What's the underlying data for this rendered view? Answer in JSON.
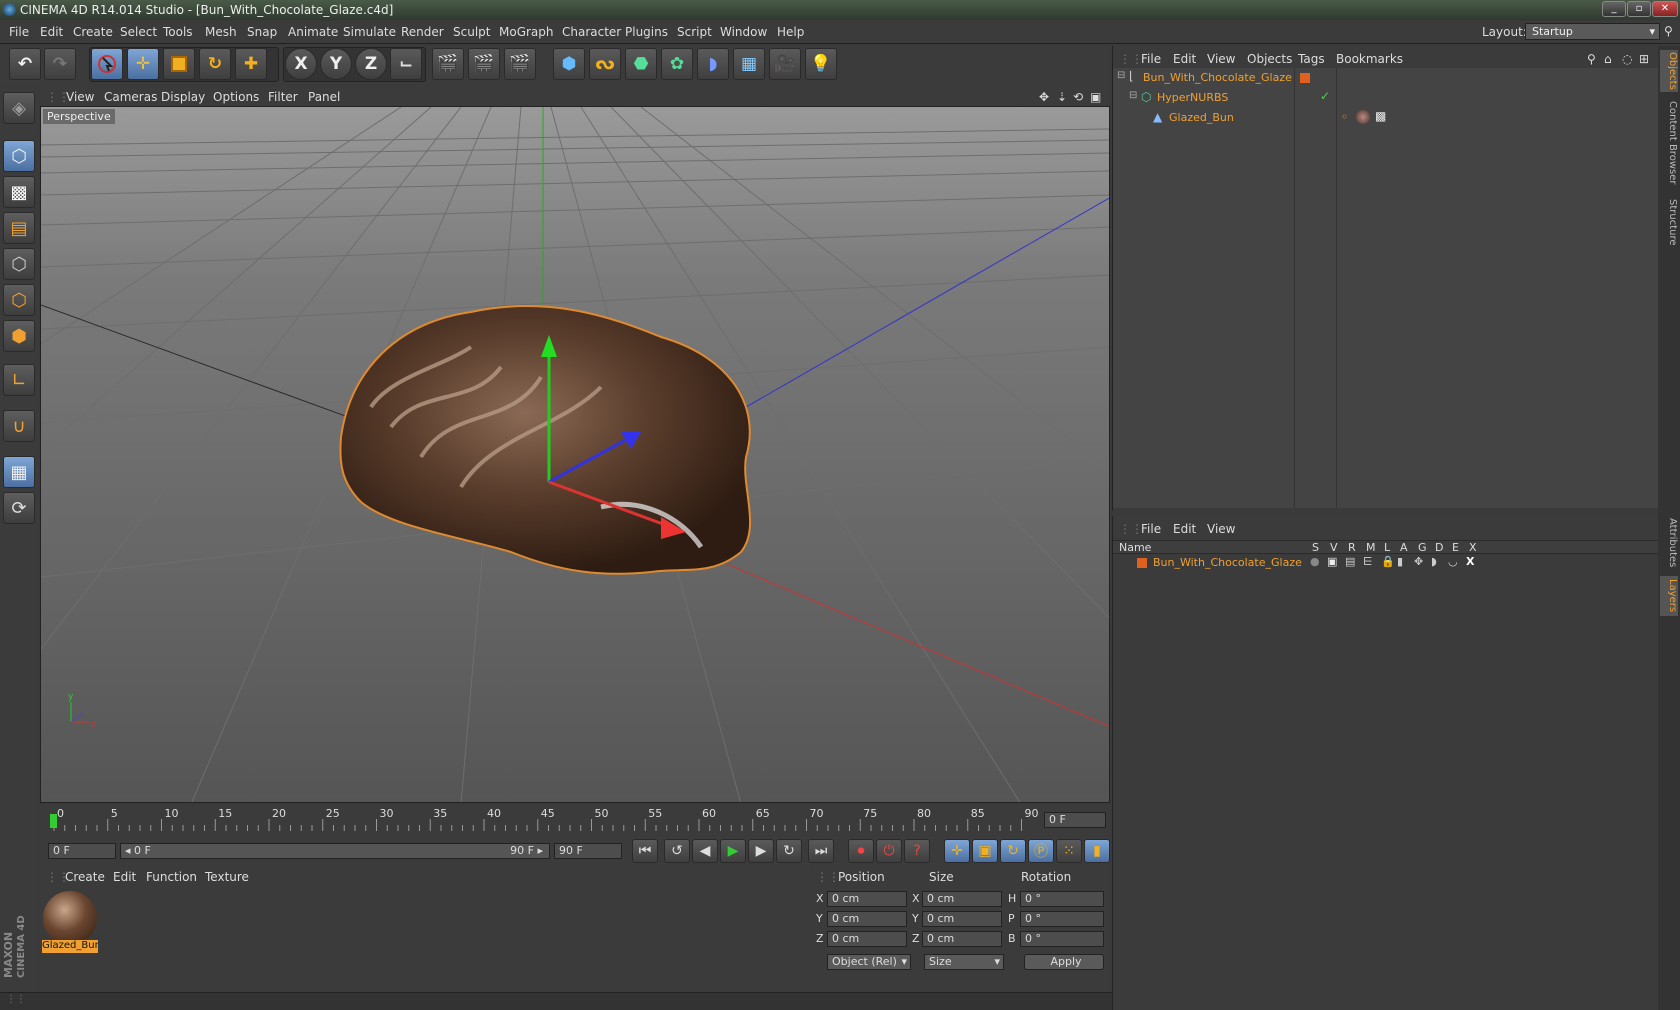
{
  "window": {
    "title": "CINEMA 4D R14.014 Studio - [Bun_With_Chocolate_Glaze.c4d]",
    "controls": [
      "_",
      "▫",
      "✕"
    ]
  },
  "menubar": {
    "items": [
      "File",
      "Edit",
      "Create",
      "Select",
      "Tools",
      "Mesh",
      "Snap",
      "Animate",
      "Simulate",
      "Render",
      "Sculpt",
      "MoGraph",
      "Character",
      "Plugins",
      "Script",
      "Window",
      "Help"
    ],
    "layout_label": "Layout:",
    "layout_value": "Startup"
  },
  "toolbar": {
    "axis_x": "X",
    "axis_y": "Y",
    "axis_z": "Z"
  },
  "viewport": {
    "menu": [
      "View",
      "Cameras",
      "Display",
      "Options",
      "Filter",
      "Panel"
    ],
    "label": "Perspective"
  },
  "timeline": {
    "ticks": [
      "0",
      "5",
      "10",
      "15",
      "20",
      "25",
      "30",
      "35",
      "40",
      "45",
      "50",
      "55",
      "60",
      "65",
      "70",
      "75",
      "80",
      "85",
      "90"
    ],
    "end_field": "0 F",
    "current_frame": "0 F",
    "range_start": "◂ 0 F",
    "range_end": "90 F ▸",
    "max_frame": "90 F"
  },
  "materials": {
    "menu": [
      "Create",
      "Edit",
      "Function",
      "Texture"
    ],
    "item_label": "Glazed_Bun",
    "logo_line1": "MAXON",
    "logo_line2": "CINEMA 4D"
  },
  "coordinates": {
    "headers": [
      "Position",
      "Size",
      "Rotation"
    ],
    "rows": [
      {
        "pos_axis": "X",
        "pos": "0 cm",
        "size_axis": "X",
        "size": "0 cm",
        "rot_axis": "H",
        "rot": "0 °"
      },
      {
        "pos_axis": "Y",
        "pos": "0 cm",
        "size_axis": "Y",
        "size": "0 cm",
        "rot_axis": "P",
        "rot": "0 °"
      },
      {
        "pos_axis": "Z",
        "pos": "0 cm",
        "size_axis": "Z",
        "size": "0 cm",
        "rot_axis": "B",
        "rot": "0 °"
      }
    ],
    "mode_select": "Object (Rel)",
    "size_select": "Size",
    "apply": "Apply"
  },
  "objects": {
    "menu": [
      "File",
      "Edit",
      "View",
      "Objects",
      "Tags",
      "Bookmarks"
    ],
    "tree": [
      "Bun_With_Chocolate_Glaze",
      "HyperNURBS",
      "Glazed_Bun"
    ]
  },
  "layers": {
    "menu": [
      "File",
      "Edit",
      "View"
    ],
    "name_header": "Name",
    "flag_headers": [
      "S",
      "V",
      "R",
      "M",
      "L",
      "A",
      "G",
      "D",
      "E",
      "X"
    ],
    "row_name": "Bun_With_Chocolate_Glaze"
  },
  "side_tabs": [
    "Objects",
    "Content Browser",
    "Structure",
    "Attributes",
    "Layers"
  ],
  "colors": {
    "accent_orange": "#f0a030",
    "active_blue": "#6f95c8",
    "panel_bg": "#3b3b3b"
  }
}
